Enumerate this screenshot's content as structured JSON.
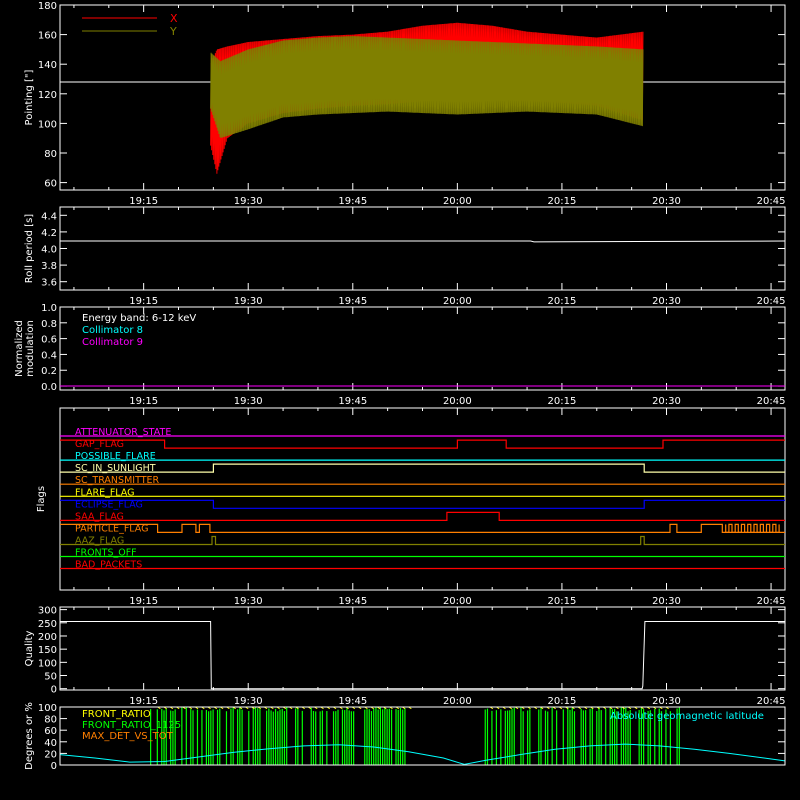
{
  "time_ticks": [
    "19:15",
    "19:30",
    "19:45",
    "20:00",
    "20:15",
    "20:30",
    "20:45"
  ],
  "chart_data": [
    {
      "id": "pointing",
      "type": "line",
      "ylabel": "Pointing [\"]",
      "ylim": [
        55,
        180
      ],
      "yticks": [
        "60",
        "80",
        "100",
        "120",
        "140",
        "160",
        "180"
      ],
      "x_unit": "minutes after 19:00",
      "x_range": [
        3,
        107
      ],
      "legend": [
        {
          "name": "X",
          "color": "#ff0000"
        },
        {
          "name": "Y",
          "color": "#808000"
        }
      ],
      "reference_line": 128,
      "data_span": [
        24.6,
        86.7
      ],
      "x_envelope": {
        "x": [
          24.6,
          25.5,
          27,
          30,
          35,
          40,
          45,
          50,
          55,
          60,
          65,
          70,
          75,
          80,
          86.7
        ],
        "upper": [
          140,
          150,
          152,
          155,
          157,
          159,
          160,
          162,
          166,
          168,
          166,
          162,
          160,
          158,
          162
        ],
        "lower": [
          85,
          66,
          90,
          100,
          107,
          110,
          112,
          113,
          115,
          116,
          116,
          115,
          114,
          112,
          102
        ]
      },
      "y_envelope": {
        "x": [
          24.6,
          26,
          30,
          35,
          40,
          45,
          50,
          55,
          60,
          65,
          70,
          75,
          80,
          86.7
        ],
        "upper": [
          148,
          142,
          150,
          156,
          158,
          159,
          158,
          157,
          156,
          155,
          154,
          153,
          152,
          150
        ],
        "lower": [
          110,
          90,
          96,
          104,
          106,
          107,
          108,
          107,
          106,
          107,
          108,
          107,
          106,
          98
        ]
      }
    },
    {
      "id": "roll",
      "type": "line",
      "ylabel": "Roll period [s]",
      "ylim": [
        3.5,
        4.5
      ],
      "yticks": [
        "3.6",
        "3.8",
        "4.0",
        "4.2",
        "4.4"
      ],
      "series": [
        {
          "name": "",
          "color": "#ffffff",
          "x": [
            3,
            70.5,
            71,
            107
          ],
          "y": [
            4.09,
            4.09,
            4.08,
            4.09
          ]
        }
      ]
    },
    {
      "id": "modulation",
      "type": "line",
      "ylabel": "Normalized modulation",
      "ylim": [
        -0.05,
        1.0
      ],
      "yticks": [
        "0.0",
        "0.2",
        "0.4",
        "0.6",
        "0.8",
        "1.0"
      ],
      "legend": [
        {
          "name": "Energy band: 6-12 keV",
          "color": "#ffffff"
        },
        {
          "name": "Collimator 8",
          "color": "#00ffff"
        },
        {
          "name": "Collimator 9",
          "color": "#ff00ff"
        }
      ],
      "series": [
        {
          "name": "Collimator 9",
          "color": "#ff00ff",
          "x": [
            3,
            107
          ],
          "y": [
            0,
            0
          ]
        }
      ]
    },
    {
      "id": "flags",
      "type": "line",
      "ylabel": "Flags",
      "flags": [
        {
          "name": "ATTENUATOR_STATE",
          "color": "#ff00ff",
          "segments": [
            [
              3,
              0
            ],
            [
              107,
              0
            ]
          ]
        },
        {
          "name": "GAP_FLAG",
          "color": "#ff0000",
          "segments": [
            [
              3,
              1
            ],
            [
              18,
              1
            ],
            [
              18,
              0
            ],
            [
              60,
              0
            ],
            [
              60,
              1
            ],
            [
              67,
              1
            ],
            [
              67,
              0
            ],
            [
              89.5,
              0
            ],
            [
              89.5,
              1
            ],
            [
              107,
              1
            ]
          ]
        },
        {
          "name": "POSSIBLE_FLARE",
          "color": "#00ffff",
          "segments": [
            [
              3,
              0
            ],
            [
              107,
              0
            ]
          ]
        },
        {
          "name": "SC_IN_SUNLIGHT",
          "color": "#ffffaa",
          "segments": [
            [
              3,
              0
            ],
            [
              25,
              0
            ],
            [
              25,
              1
            ],
            [
              86.8,
              1
            ],
            [
              86.8,
              0
            ],
            [
              107,
              0
            ]
          ]
        },
        {
          "name": "SC_TRANSMITTER",
          "color": "#ff7f00",
          "segments": [
            [
              3,
              0
            ],
            [
              107,
              0
            ]
          ]
        },
        {
          "name": "FLARE_FLAG",
          "color": "#ffff00",
          "segments": [
            [
              3,
              0
            ],
            [
              107,
              0
            ]
          ]
        },
        {
          "name": "ECLIPSE_FLAG",
          "color": "#0000ff",
          "segments": [
            [
              3,
              1
            ],
            [
              25,
              1
            ],
            [
              25,
              0
            ],
            [
              86.8,
              0
            ],
            [
              86.8,
              1
            ],
            [
              107,
              1
            ]
          ]
        },
        {
          "name": "SAA_FLAG",
          "color": "#ff0000",
          "segments": [
            [
              3,
              0
            ],
            [
              58.5,
              0
            ],
            [
              58.5,
              1
            ],
            [
              66,
              1
            ],
            [
              66,
              0
            ],
            [
              107,
              0
            ]
          ]
        },
        {
          "name": "PARTICLE_FLAG",
          "color": "#ff7f00",
          "segments": [
            [
              3,
              1
            ],
            [
              17,
              1
            ],
            [
              17,
              0
            ],
            [
              20.5,
              0
            ],
            [
              20.5,
              1
            ],
            [
              22.5,
              1
            ],
            [
              22.5,
              0
            ],
            [
              23,
              0
            ],
            [
              23,
              1
            ],
            [
              24.5,
              1
            ],
            [
              24.5,
              0
            ],
            [
              90.5,
              0
            ],
            [
              90.5,
              1
            ],
            [
              91.5,
              1
            ],
            [
              91.5,
              0
            ],
            [
              95,
              0
            ],
            [
              95,
              1
            ],
            [
              98,
              1
            ],
            [
              98,
              0
            ],
            [
              107,
              0
            ]
          ]
        },
        {
          "name": "AAZ_FLAG",
          "color": "#808000",
          "segments": [
            [
              3,
              0
            ],
            [
              24.8,
              0
            ],
            [
              24.8,
              1
            ],
            [
              25.3,
              1
            ],
            [
              25.3,
              0
            ],
            [
              86.3,
              0
            ],
            [
              86.3,
              1
            ],
            [
              86.8,
              1
            ],
            [
              86.8,
              0
            ],
            [
              107,
              0
            ]
          ]
        },
        {
          "name": "FRONTS_OFF",
          "color": "#00ff00",
          "segments": [
            [
              3,
              0
            ],
            [
              107,
              0
            ]
          ]
        },
        {
          "name": "BAD_PACKETS",
          "color": "#ff0000",
          "segments": [
            [
              3,
              0
            ],
            [
              107,
              0
            ]
          ]
        }
      ]
    },
    {
      "id": "quality",
      "type": "line",
      "ylabel": "Quality",
      "ylim": [
        -5,
        310
      ],
      "yticks": [
        "0",
        "50",
        "100",
        "150",
        "200",
        "250",
        "300"
      ],
      "series": [
        {
          "name": "",
          "color": "#ffffff",
          "x": [
            3,
            24.6,
            24.7,
            86.5,
            86.6,
            86.9,
            107
          ],
          "y": [
            255,
            255,
            0,
            0,
            10,
            255,
            255
          ]
        }
      ]
    },
    {
      "id": "ratios",
      "type": "line",
      "ylabel": "Degrees or %",
      "ylim": [
        0,
        100
      ],
      "yticks": [
        "0",
        "20",
        "40",
        "60",
        "80",
        "100"
      ],
      "legend": [
        {
          "name": "FRONT_RATIO",
          "color": "#ffff00"
        },
        {
          "name": "FRONT_RATIO_1125",
          "color": "#00ff00"
        },
        {
          "name": "MAX_DET_VS_TOT",
          "color": "#ff7f00"
        },
        {
          "name": "Absolute geomagnetic latitude",
          "color": "#00ffff"
        }
      ],
      "green_spans": [
        [
          16,
          53
        ],
        [
          64,
          92
        ]
      ],
      "latitude": {
        "x": [
          3,
          8,
          13,
          18,
          23,
          28,
          33,
          38,
          43,
          48,
          53,
          58,
          61,
          64,
          69,
          74,
          79,
          84,
          89,
          94,
          99,
          104,
          107
        ],
        "y": [
          18,
          12,
          5,
          6,
          14,
          22,
          28,
          33,
          35,
          31,
          23,
          12,
          1,
          8,
          18,
          27,
          33,
          36,
          33,
          27,
          20,
          12,
          7
        ]
      }
    }
  ]
}
